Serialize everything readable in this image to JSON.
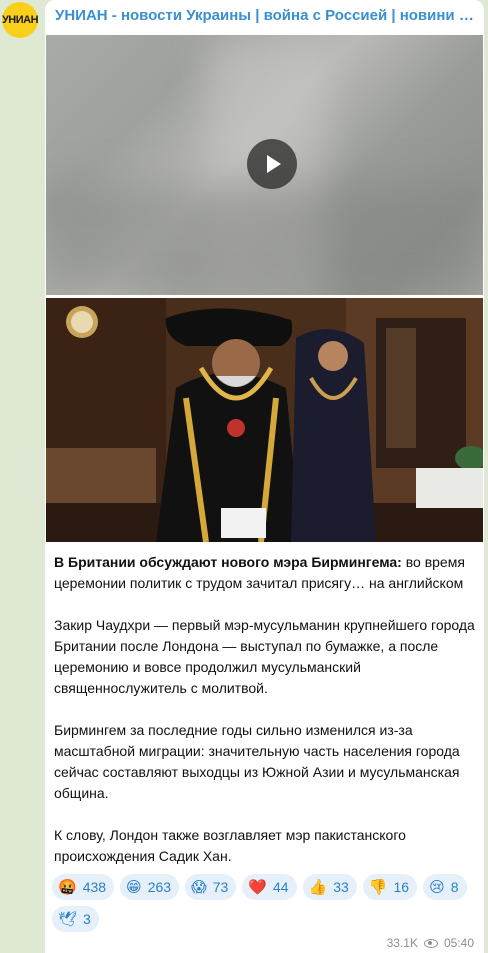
{
  "channel": {
    "avatar_text": "УНИАН",
    "title": "УНИАН - новости Украины | война с Россией | новини України | Україна"
  },
  "post": {
    "lead_bold": "В Британии обсуждают нового мэра Бирмингема:",
    "lead_rest": " во время церемонии политик с трудом зачитал присягу… на английском",
    "paragraphs": [
      "Закир Чаудхри — первый мэр-мусульманин крупнейшего города Британии после Лондона — выступал по бумажке, а после церемонию и вовсе продолжил мусульманский священнослужитель с молитвой.",
      "Бирмингем за последние годы сильно изменился из-за масштабной миграции: значительную часть населения города сейчас составляют выходцы из Южной Азии и мусульманская община.",
      "К слову, Лондон также возглавляет мэр пакистанского происхождения Садик Хан."
    ]
  },
  "reactions": [
    {
      "emoji": "🤬",
      "count": "438"
    },
    {
      "emoji": "😁",
      "count": "263"
    },
    {
      "emoji": "😱",
      "count": "73"
    },
    {
      "emoji": "❤️",
      "count": "44"
    },
    {
      "emoji": "👍",
      "count": "33"
    },
    {
      "emoji": "👎",
      "count": "16"
    },
    {
      "emoji": "😢",
      "count": "8"
    },
    {
      "emoji": "🕊",
      "count": "3"
    }
  ],
  "meta": {
    "views": "33.1K",
    "time": "05:40"
  },
  "colors": {
    "accent": "#3a8fd0",
    "reaction_bg": "#e6f0fa",
    "chat_bg": "#dfe8d2"
  }
}
